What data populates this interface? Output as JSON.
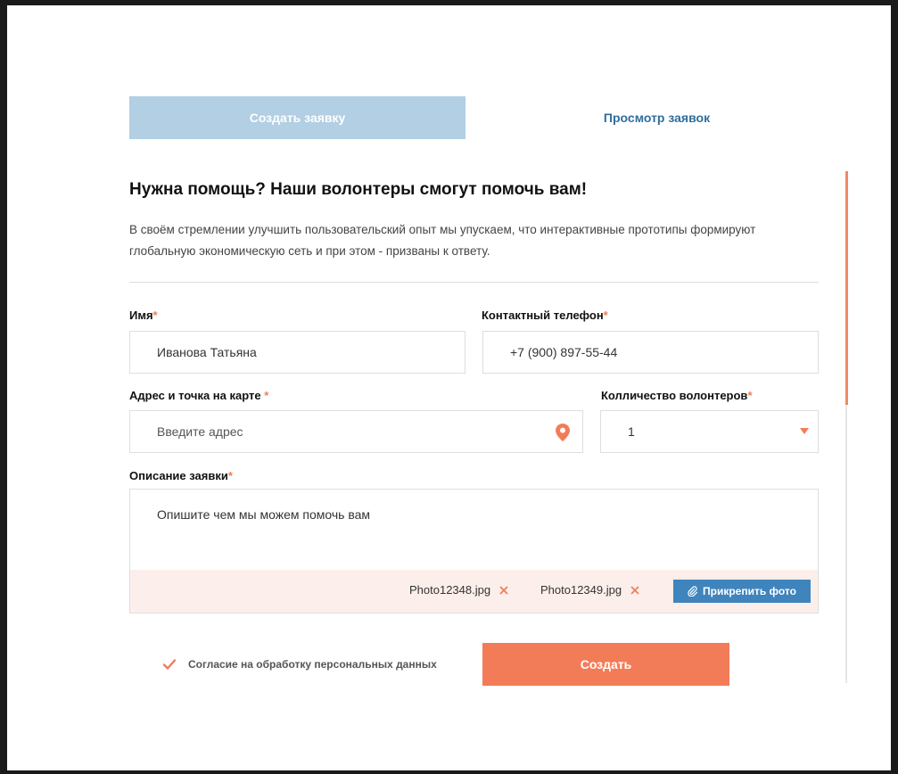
{
  "tabs": {
    "create": "Создать заявку",
    "view": "Просмотр заявок"
  },
  "form": {
    "heading": "Нужна помощь? Наши волонтеры смогут помочь вам!",
    "description": "В своём стремлении улучшить пользовательский опыт мы упускаем, что интерактивные прототипы формируют глобальную экономическую сеть и при этом - призваны к ответу.",
    "required_mark": "*",
    "name": {
      "label": "Имя",
      "value": "Иванова Татьяна"
    },
    "phone": {
      "label": "Контактный телефон",
      "value": "+7 (900) 897-55-44"
    },
    "address": {
      "label": "Адрес и точка на карте",
      "placeholder": "Введите адрес",
      "icon": "map-pin-icon"
    },
    "volunteers": {
      "label": "Колличество волонтеров",
      "value": "1",
      "icon": "chevron-down-icon"
    },
    "request_description": {
      "label": "Описание заявки",
      "placeholder": "Опишите чем мы можем помочь вам"
    },
    "attachments": [
      {
        "name": "Photo12348.jpg"
      },
      {
        "name": "Photo12349.jpg"
      }
    ],
    "attach_button": "Прикрепить фото",
    "consent": {
      "label": "Согласие на обработку персональных данных",
      "checked": true
    },
    "submit": "Создать"
  },
  "colors": {
    "tab_active_bg": "#b2cfe3",
    "link_blue": "#2f6e9d",
    "accent_orange": "#f27c58",
    "attach_button_bg": "#3f84bd",
    "attach_bar_bg": "#fcefeb"
  }
}
